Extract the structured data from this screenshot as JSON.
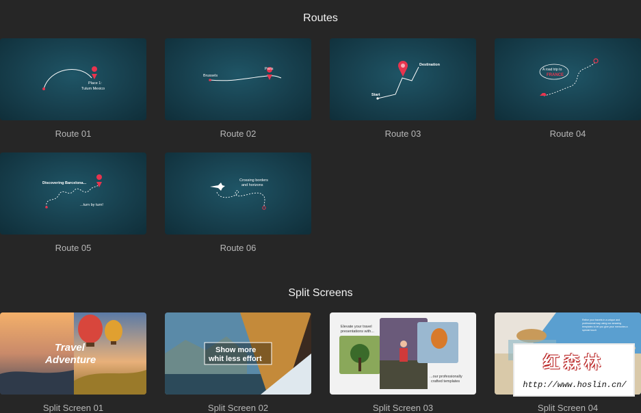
{
  "sections": {
    "routes_title": "Routes",
    "split_title": "Split Screens"
  },
  "routes": [
    {
      "label": "Route 01",
      "text": [
        "Place 1:",
        "Tulum Mexico"
      ]
    },
    {
      "label": "Route 02",
      "text": [
        "Brussels",
        "Paris"
      ]
    },
    {
      "label": "Route 03",
      "text": [
        "Start",
        "Destination"
      ]
    },
    {
      "label": "Route 04",
      "text": [
        "A road trip to",
        "FRANCE"
      ]
    },
    {
      "label": "Route 05",
      "text": [
        "Discovering Barcelona...",
        "...turn by turn!"
      ]
    },
    {
      "label": "Route 06",
      "text": [
        "Crossing borders",
        "and horizons"
      ]
    }
  ],
  "splits": [
    {
      "label": "Split Screen 01",
      "text": [
        "Travel",
        "Adventure"
      ]
    },
    {
      "label": "Split Screen 02",
      "text": [
        "Show more",
        "whit less effort"
      ]
    },
    {
      "label": "Split Screen 03",
      "text": [
        "Elevate your travel",
        "presentations with...",
        "...our professionally",
        "crafted templates"
      ]
    },
    {
      "label": "Split Screen 04",
      "text": [
        "Relive your travels in a unique and",
        "professional way using our amazing",
        "templates to let you give your memories a",
        "special touch"
      ]
    }
  ],
  "watermark": {
    "cn": "红森林",
    "url": "http://www.hoslin.cn/"
  },
  "colors": {
    "pin": "#e8344e",
    "route_bg": "#173f4d"
  }
}
